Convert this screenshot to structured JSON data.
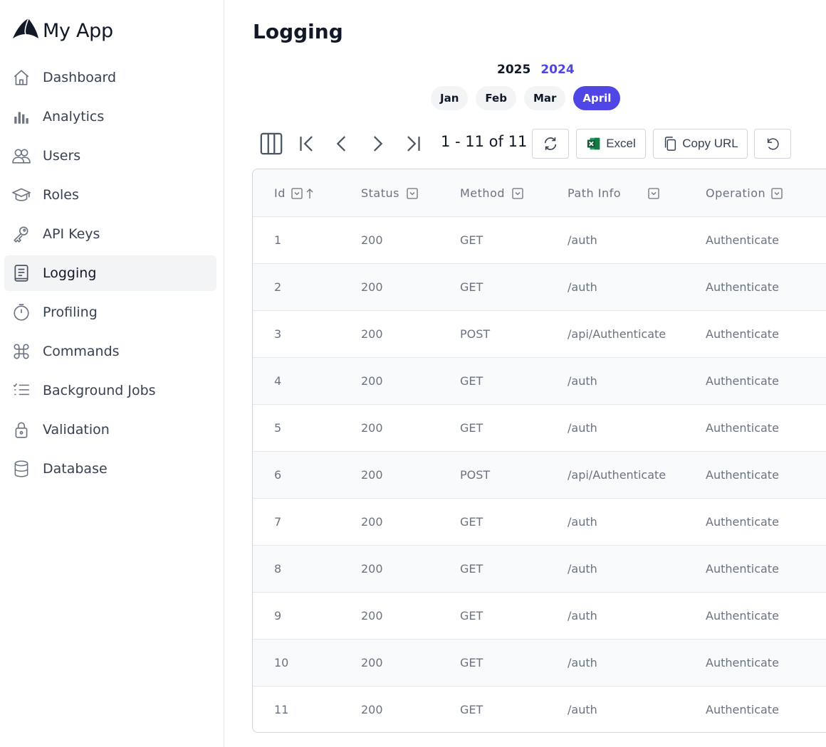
{
  "brand": {
    "name": "My App"
  },
  "sidebar": {
    "items": [
      {
        "label": "Dashboard",
        "icon": "home-icon",
        "active": false
      },
      {
        "label": "Analytics",
        "icon": "bar-chart-icon",
        "active": false
      },
      {
        "label": "Users",
        "icon": "users-icon",
        "active": false
      },
      {
        "label": "Roles",
        "icon": "graduation-cap-icon",
        "active": false
      },
      {
        "label": "API Keys",
        "icon": "key-icon",
        "active": false
      },
      {
        "label": "Logging",
        "icon": "log-document-icon",
        "active": true
      },
      {
        "label": "Profiling",
        "icon": "stopwatch-icon",
        "active": false
      },
      {
        "label": "Commands",
        "icon": "command-icon",
        "active": false
      },
      {
        "label": "Background Jobs",
        "icon": "checklist-icon",
        "active": false
      },
      {
        "label": "Validation",
        "icon": "lock-icon",
        "active": false
      },
      {
        "label": "Database",
        "icon": "database-icon",
        "active": false
      }
    ]
  },
  "page": {
    "title": "Logging"
  },
  "years": {
    "current": "2025",
    "other": "2024"
  },
  "months": [
    "Jan",
    "Feb",
    "Mar",
    "April"
  ],
  "active_month": "April",
  "toolbar": {
    "pager_text": "1 - 11 of 11",
    "excel_label": "Excel",
    "copy_url_label": "Copy URL"
  },
  "table": {
    "columns": [
      "Id",
      "Status",
      "Method",
      "Path Info",
      "Operation"
    ],
    "rows": [
      [
        "1",
        "200",
        "GET",
        "/auth",
        "Authenticate"
      ],
      [
        "2",
        "200",
        "GET",
        "/auth",
        "Authenticate"
      ],
      [
        "3",
        "200",
        "POST",
        "/api/Authenticate",
        "Authenticate"
      ],
      [
        "4",
        "200",
        "GET",
        "/auth",
        "Authenticate"
      ],
      [
        "5",
        "200",
        "GET",
        "/auth",
        "Authenticate"
      ],
      [
        "6",
        "200",
        "POST",
        "/api/Authenticate",
        "Authenticate"
      ],
      [
        "7",
        "200",
        "GET",
        "/auth",
        "Authenticate"
      ],
      [
        "8",
        "200",
        "GET",
        "/auth",
        "Authenticate"
      ],
      [
        "9",
        "200",
        "GET",
        "/auth",
        "Authenticate"
      ],
      [
        "10",
        "200",
        "GET",
        "/auth",
        "Authenticate"
      ],
      [
        "11",
        "200",
        "GET",
        "/auth",
        "Authenticate"
      ]
    ]
  },
  "colors": {
    "accent": "#4f46e5",
    "excel_green": "#1d6f42"
  }
}
